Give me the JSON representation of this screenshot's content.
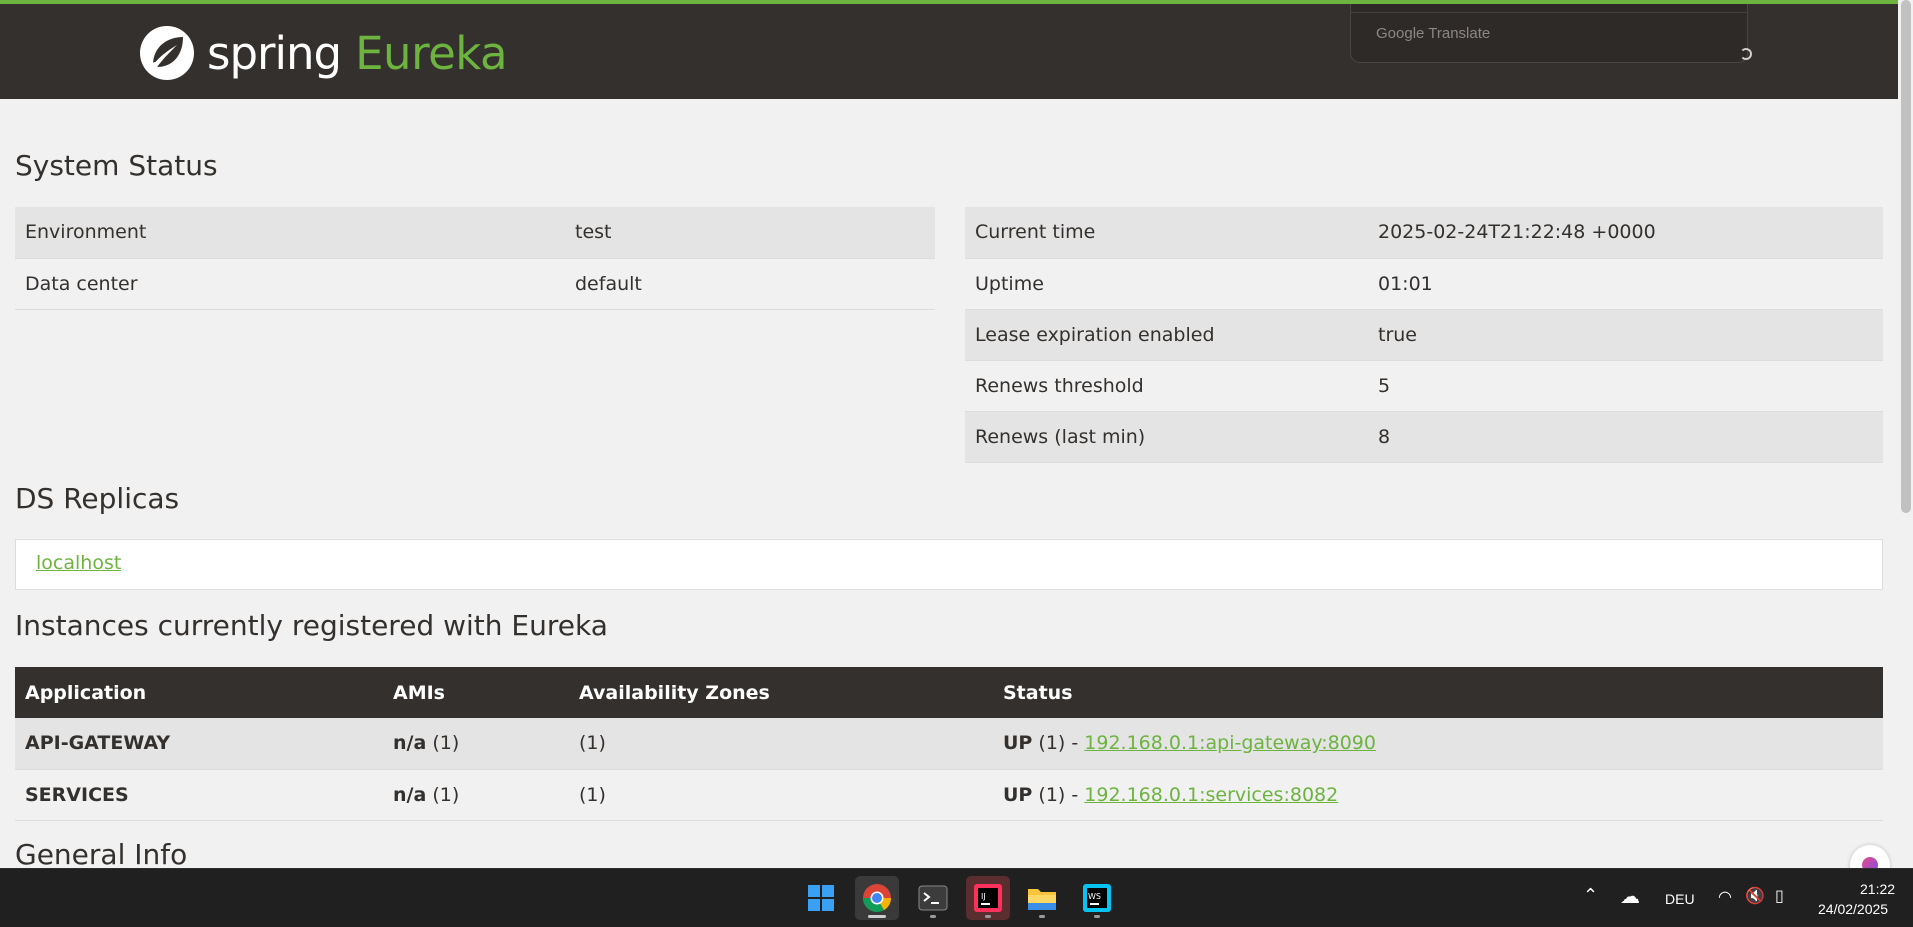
{
  "header": {
    "brand_spring": "spring",
    "brand_eureka": "Eureka",
    "translate_popup": "Google Translate"
  },
  "system_status": {
    "title": "System Status",
    "left": [
      {
        "label": "Environment",
        "value": "test"
      },
      {
        "label": "Data center",
        "value": "default"
      }
    ],
    "right": [
      {
        "label": "Current time",
        "value": "2025-02-24T21:22:48 +0000"
      },
      {
        "label": "Uptime",
        "value": "01:01"
      },
      {
        "label": "Lease expiration enabled",
        "value": "true"
      },
      {
        "label": "Renews threshold",
        "value": "5"
      },
      {
        "label": "Renews (last min)",
        "value": "8"
      }
    ]
  },
  "ds_replicas": {
    "title": "DS Replicas",
    "link": "localhost"
  },
  "instances": {
    "title": "Instances currently registered with Eureka",
    "columns": [
      "Application",
      "AMIs",
      "Availability Zones",
      "Status"
    ],
    "rows": [
      {
        "application": "API-GATEWAY",
        "ami": "n/a",
        "ami_count": "(1)",
        "zones": "(1)",
        "status": "UP",
        "status_count": "(1) -",
        "link": "192.168.0.1:api-gateway:8090"
      },
      {
        "application": "SERVICES",
        "ami": "n/a",
        "ami_count": "(1)",
        "zones": "(1)",
        "status": "UP",
        "status_count": "(1) -",
        "link": "192.168.0.1:services:8082"
      }
    ]
  },
  "general_info": {
    "title": "General Info"
  },
  "taskbar": {
    "apps": [
      "windows-start-icon",
      "chrome-icon",
      "terminal-icon",
      "intellij-icon",
      "file-explorer-icon",
      "webstorm-icon"
    ],
    "language": "DEU",
    "time": "21:22",
    "date": "24/02/2025"
  },
  "colors": {
    "header_bg": "#34302d",
    "accent_green": "#6db33f",
    "page_bg": "#f1f1f1",
    "row_alt": "#e4e4e4"
  }
}
